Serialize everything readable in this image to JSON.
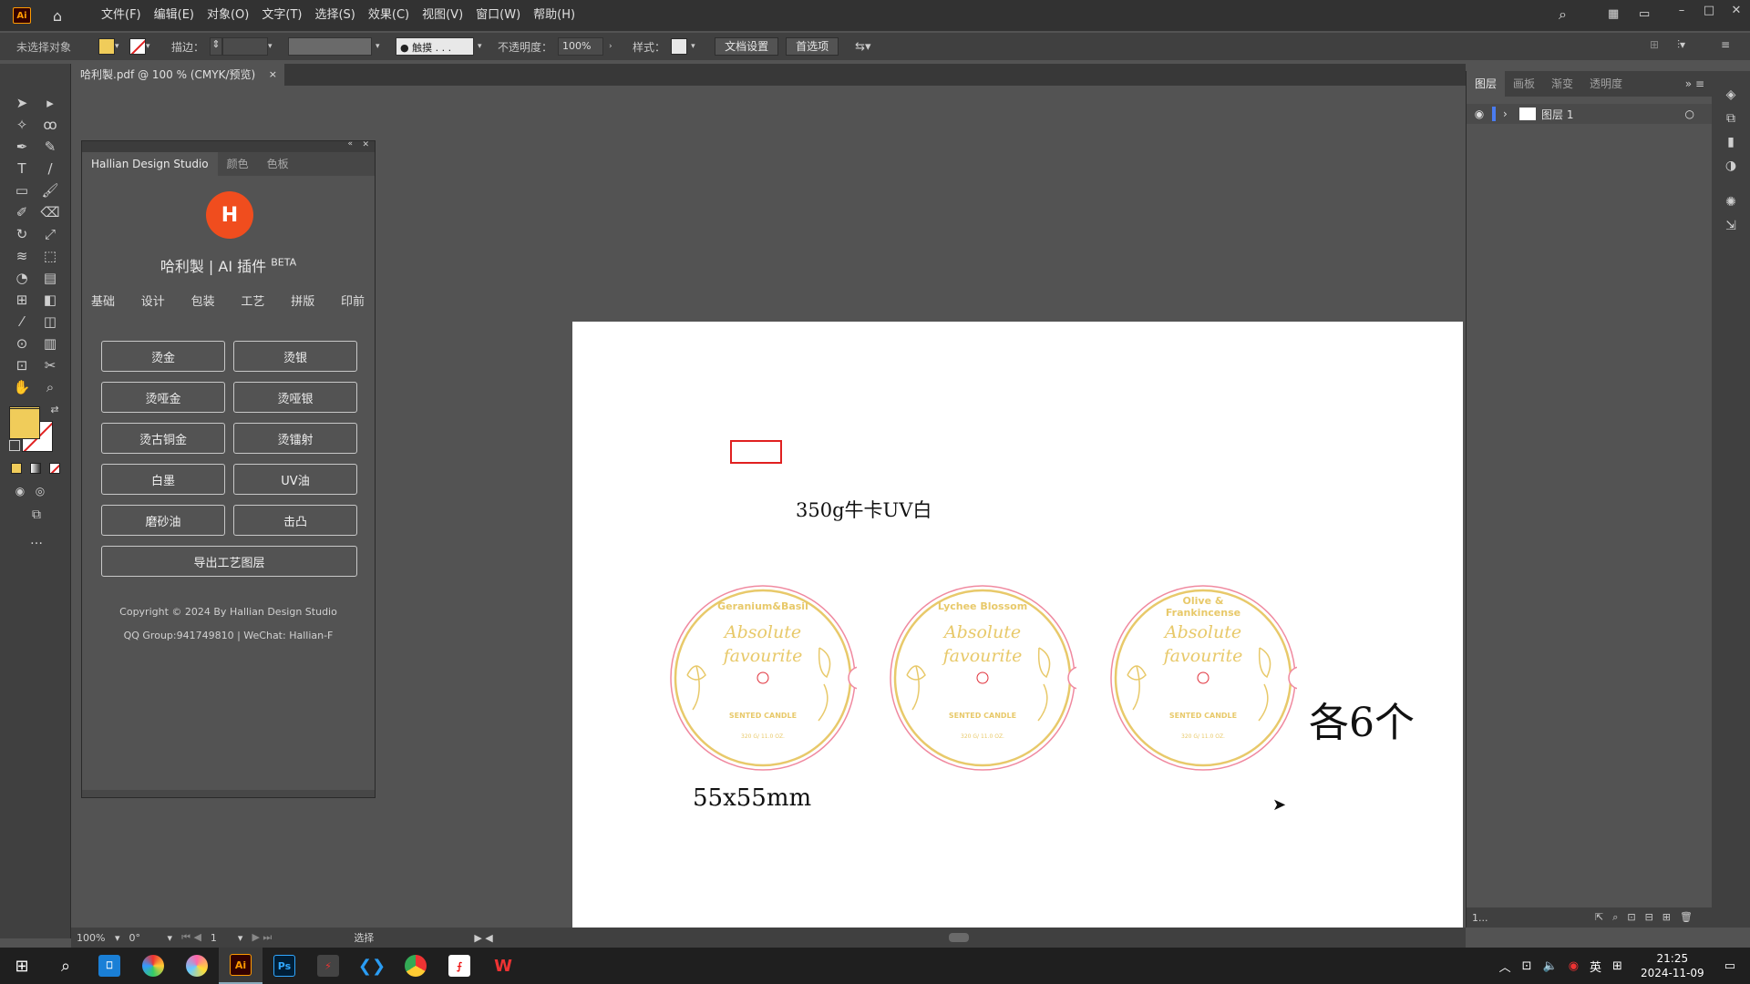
{
  "app": {
    "logo": "Ai",
    "menu": [
      "文件(F)",
      "编辑(E)",
      "对象(O)",
      "文字(T)",
      "选择(S)",
      "效果(C)",
      "视图(V)",
      "窗口(W)",
      "帮助(H)"
    ]
  },
  "controlbar": {
    "selection": "未选择对象",
    "fill_color": "#f0cc5a",
    "stroke_label": "描边：",
    "brush": "● 触摸 . . .",
    "opacity_label": "不透明度：",
    "opacity": "100%",
    "style_label": "样式：",
    "doc_setup": "文档设置",
    "prefs": "首选项"
  },
  "document": {
    "tab_title": "哈利製.pdf @ 100 % (CMYK/预览)",
    "close": "×"
  },
  "plugin": {
    "tabs": [
      "Hallian Design Studio",
      "颜色",
      "色板"
    ],
    "logo_text": "H",
    "title": "哈利製 | AI 插件",
    "beta": "BETA",
    "nav": [
      "基础",
      "设计",
      "包装",
      "工艺",
      "拼版",
      "印前"
    ],
    "buttons": [
      "烫金",
      "烫银",
      "烫哑金",
      "烫哑银",
      "烫古铜金",
      "烫镭射",
      "白墨",
      "UV油",
      "磨砂油",
      "击凸"
    ],
    "export": "导出工艺图层",
    "copyright": "Copyright © 2024 By Hallian Design Studio",
    "contact": "QQ Group:941749810 | WeChat: Hallian-F"
  },
  "artboard": {
    "material": "350g牛卡UV白",
    "size": "55x55mm",
    "quantity": "各6个",
    "labels": [
      {
        "name": "Geranium&Basil",
        "script1": "Absolute",
        "script2": "favourite",
        "sub": "SENTED CANDLE",
        "weight": "320 G/ 11.0 OZ."
      },
      {
        "name": "Lychee Blossom",
        "script1": "Absolute",
        "script2": "favourite",
        "sub": "SENTED CANDLE",
        "weight": "320 G/ 11.0 OZ."
      },
      {
        "name": "Olive & Frankincense",
        "script1": "Absolute",
        "script2": "favourite",
        "sub": "SENTED CANDLE",
        "weight": "320 G/ 11.0 OZ."
      }
    ],
    "gold": "#e8c96a",
    "red": "#e0303a"
  },
  "rightpanel": {
    "tabs": [
      "图层",
      "画板",
      "渐变",
      "透明度"
    ],
    "layer_name": "图层 1",
    "layer_count": "1..."
  },
  "statusbar": {
    "zoom": "100%",
    "rotation": "0°",
    "page": "1",
    "tool": "选择"
  },
  "taskbar": {
    "ime": "英",
    "time": "21:25",
    "date": "2024-11-09"
  }
}
